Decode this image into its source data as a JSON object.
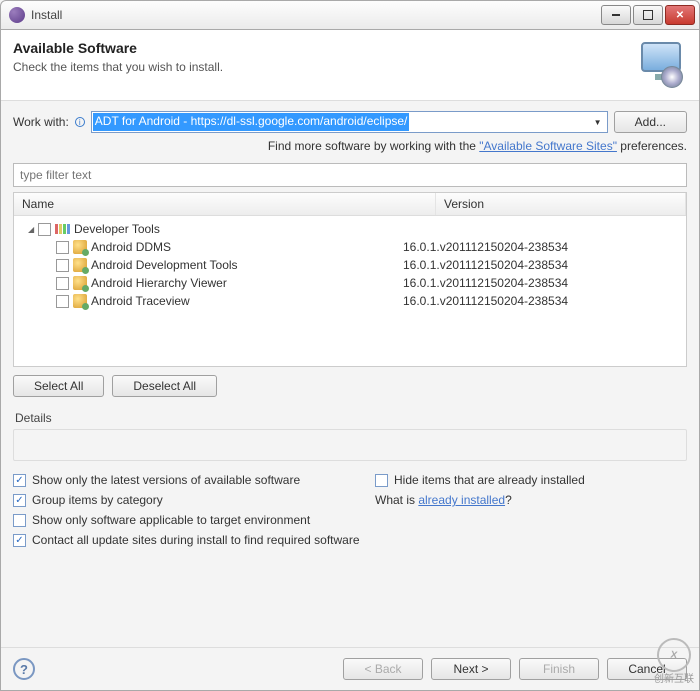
{
  "titlebar": {
    "title": "Install"
  },
  "banner": {
    "heading": "Available Software",
    "subheading": "Check the items that you wish to install."
  },
  "workWith": {
    "label": "Work with:",
    "value": "ADT for Android - https://dl-ssl.google.com/android/eclipse/",
    "addButton": "Add..."
  },
  "sitesLine": {
    "prefix": "Find more software by working with the ",
    "link": "\"Available Software Sites\"",
    "suffix": " preferences."
  },
  "filter": {
    "placeholder": "type filter text"
  },
  "columns": {
    "name": "Name",
    "version": "Version"
  },
  "tree": {
    "group": "Developer Tools",
    "items": [
      {
        "name": "Android DDMS",
        "version": "16.0.1.v201112150204-238534"
      },
      {
        "name": "Android Development Tools",
        "version": "16.0.1.v201112150204-238534"
      },
      {
        "name": "Android Hierarchy Viewer",
        "version": "16.0.1.v201112150204-238534"
      },
      {
        "name": "Android Traceview",
        "version": "16.0.1.v201112150204-238534"
      }
    ]
  },
  "buttons": {
    "selectAll": "Select All",
    "deselectAll": "Deselect All",
    "back": "< Back",
    "next": "Next >",
    "finish": "Finish",
    "cancel": "Cancel"
  },
  "details": {
    "label": "Details"
  },
  "options": {
    "showLatest": "Show only the latest versions of available software",
    "hideInstalled": "Hide items that are already installed",
    "groupByCategory": "Group items by category",
    "whatIs": "What is ",
    "alreadyInstalled": "already installed",
    "showApplicable": "Show only software applicable to target environment",
    "contactSites": "Contact all update sites during install to find required software",
    "checked": {
      "showLatest": true,
      "hideInstalled": false,
      "groupByCategory": true,
      "showApplicable": false,
      "contactSites": true
    }
  },
  "help": "?",
  "brand": {
    "logo": "X",
    "text": "创新互联"
  }
}
